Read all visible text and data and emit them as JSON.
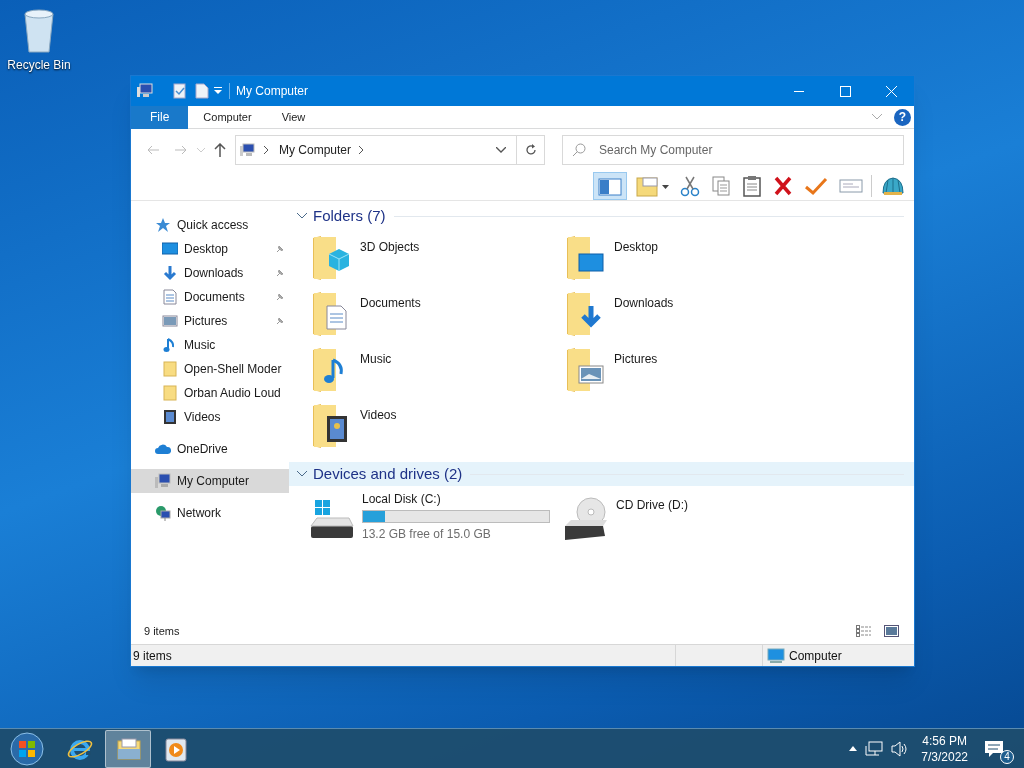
{
  "desktop_icons": [
    {
      "label": "Recycle Bin"
    }
  ],
  "window": {
    "title": "My Computer",
    "ribbon_tabs": [
      {
        "label": "File",
        "kind": "file"
      },
      {
        "label": "Computer",
        "kind": "tab"
      },
      {
        "label": "View",
        "kind": "tab"
      }
    ],
    "help_label": "?",
    "address": {
      "path": "My Computer"
    },
    "search": {
      "placeholder": "Search My Computer"
    },
    "navigation": [
      {
        "label": "Quick access",
        "kind": "star",
        "selected": false,
        "children": [
          {
            "label": "Desktop",
            "kind": "desktop",
            "pinned": true,
            "selected": false
          },
          {
            "label": "Downloads",
            "kind": "download",
            "pinned": true,
            "selected": false
          },
          {
            "label": "Documents",
            "kind": "document",
            "pinned": true,
            "selected": false
          },
          {
            "label": "Pictures",
            "kind": "picture",
            "pinned": true,
            "selected": false
          },
          {
            "label": "Music",
            "kind": "music",
            "pinned": false,
            "selected": false
          },
          {
            "label": "Open-Shell Moder",
            "kind": "folder",
            "pinned": false,
            "selected": false
          },
          {
            "label": "Orban Audio Loud",
            "kind": "folder",
            "pinned": false,
            "selected": false
          },
          {
            "label": "Videos",
            "kind": "video",
            "pinned": false,
            "selected": false
          }
        ]
      },
      {
        "label": "OneDrive",
        "kind": "cloud",
        "selected": false
      },
      {
        "label": "My Computer",
        "kind": "computer",
        "selected": true
      },
      {
        "label": "Network",
        "kind": "network",
        "selected": false
      }
    ],
    "sections": [
      {
        "title": "Folders (7)",
        "highlighted": false,
        "items": [
          {
            "kind": "cube",
            "label": "3D Objects"
          },
          {
            "kind": "desktop",
            "label": "Desktop"
          },
          {
            "kind": "document",
            "label": "Documents"
          },
          {
            "kind": "download",
            "label": "Downloads"
          },
          {
            "kind": "music",
            "label": "Music"
          },
          {
            "kind": "picture",
            "label": "Pictures"
          },
          {
            "kind": "video",
            "label": "Videos"
          }
        ]
      },
      {
        "title": "Devices and drives (2)",
        "highlighted": true,
        "items": [
          {
            "kind": "disk",
            "label": "Local Disk (C:)",
            "level": 0.12,
            "free": "13.2 GB free of 15.0 GB"
          },
          {
            "kind": "cd",
            "label": "CD Drive (D:)"
          }
        ]
      }
    ],
    "item_count": "9 items",
    "status_bar": {
      "left": "9 items",
      "location": "Computer"
    }
  },
  "taskbar": {
    "apps": [
      {
        "kind": "ie",
        "selected": false
      },
      {
        "kind": "explorer",
        "selected": true
      },
      {
        "kind": "media",
        "selected": false
      }
    ],
    "time": "4:56 PM",
    "date": "7/3/2022",
    "notification_count": "4"
  }
}
